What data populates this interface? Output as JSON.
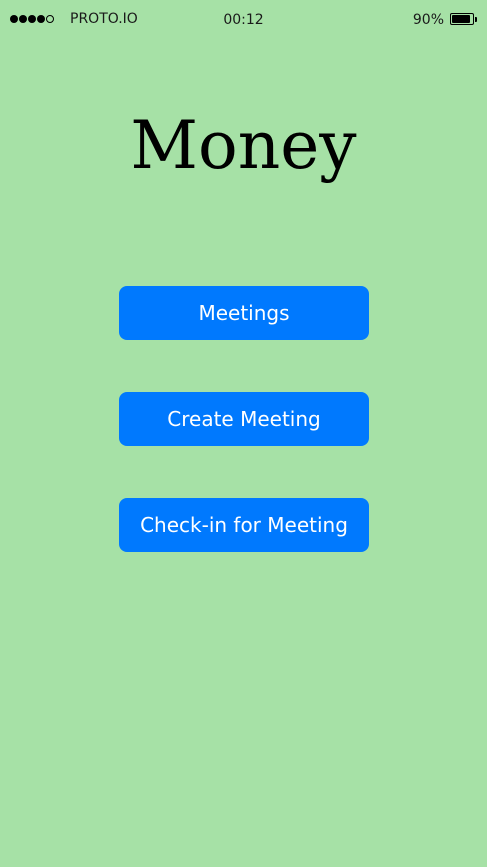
{
  "status_bar": {
    "signal_bars_filled": 4,
    "signal_bars_total": 5,
    "carrier": "PROTO.IO",
    "time": "00:12",
    "battery_percent": "90%",
    "battery_level": 0.9
  },
  "title": "Money",
  "buttons": {
    "meetings": "Meetings",
    "create_meeting": "Create Meeting",
    "check_in": "Check-in for Meeting"
  },
  "colors": {
    "background": "#a6e1a6",
    "button": "#0079fe",
    "button_text": "#ffffff"
  }
}
